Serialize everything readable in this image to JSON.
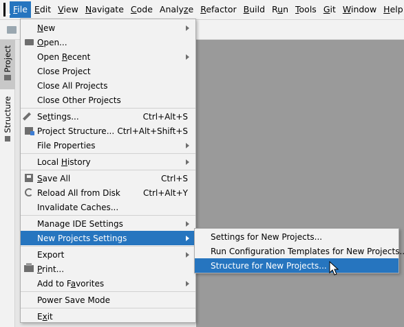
{
  "menubar": {
    "items": [
      {
        "label": "File",
        "mnemonic": "F",
        "rest": "ile",
        "active": true
      },
      {
        "label": "Edit",
        "mnemonic": "E",
        "rest": "dit"
      },
      {
        "label": "View",
        "mnemonic": "V",
        "rest": "iew"
      },
      {
        "label": "Navigate",
        "mnemonic": "N",
        "rest": "avigate"
      },
      {
        "label": "Code",
        "mnemonic": "C",
        "rest": "ode"
      },
      {
        "label": "Analyze",
        "pre": "Analy",
        "mnemonic": "z",
        "rest": "e"
      },
      {
        "label": "Refactor",
        "mnemonic": "R",
        "rest": "efactor"
      },
      {
        "label": "Build",
        "mnemonic": "B",
        "rest": "uild"
      },
      {
        "label": "Run",
        "pre": "R",
        "mnemonic": "u",
        "rest": "n"
      },
      {
        "label": "Tools",
        "mnemonic": "T",
        "rest": "ools"
      },
      {
        "label": "Git",
        "mnemonic": "G",
        "rest": "it"
      },
      {
        "label": "Window",
        "mnemonic": "W",
        "rest": "indow"
      },
      {
        "label": "Help",
        "mnemonic": "H",
        "rest": "elp"
      }
    ]
  },
  "left_stripe": {
    "project_tab": "Project",
    "structure_tab": "Structure"
  },
  "file_menu": {
    "items": [
      {
        "id": "new",
        "label": "New",
        "submenu": true
      },
      {
        "id": "open",
        "label": "Open...",
        "icon": "folder-icon"
      },
      {
        "id": "open-recent",
        "label": "Open Recent",
        "submenu": true
      },
      {
        "id": "close-project",
        "label": "Close Project"
      },
      {
        "id": "close-all-projects",
        "label": "Close All Projects"
      },
      {
        "id": "close-other-projects",
        "label": "Close Other Projects"
      },
      {
        "id": "settings",
        "label": "Settings...",
        "shortcut": "Ctrl+Alt+S",
        "icon": "wrench-icon"
      },
      {
        "id": "project-structure",
        "label": "Project Structure...",
        "shortcut": "Ctrl+Alt+Shift+S",
        "icon": "project-structure-icon"
      },
      {
        "id": "file-properties",
        "label": "File Properties",
        "submenu": true
      },
      {
        "id": "local-history",
        "label": "Local History",
        "submenu": true
      },
      {
        "id": "save-all",
        "label": "Save All",
        "shortcut": "Ctrl+S",
        "icon": "save-icon"
      },
      {
        "id": "reload-all",
        "label": "Reload All from Disk",
        "shortcut": "Ctrl+Alt+Y",
        "icon": "reload-icon"
      },
      {
        "id": "invalidate-caches",
        "label": "Invalidate Caches..."
      },
      {
        "id": "manage-ide-settings",
        "label": "Manage IDE Settings",
        "submenu": true
      },
      {
        "id": "new-projects-settings",
        "label": "New Projects Settings",
        "submenu": true,
        "selected": true
      },
      {
        "id": "export",
        "label": "Export",
        "submenu": true
      },
      {
        "id": "print",
        "label": "Print...",
        "icon": "print-icon"
      },
      {
        "id": "add-to-favorites",
        "label": "Add to Favorites",
        "submenu": true
      },
      {
        "id": "power-save-mode",
        "label": "Power Save Mode"
      },
      {
        "id": "exit",
        "label": "Exit"
      }
    ]
  },
  "submenu": {
    "items": [
      {
        "label": "Settings for New Projects..."
      },
      {
        "label": "Run Configuration Templates for New Projects..."
      },
      {
        "label": "Structure for New Projects...",
        "selected": true
      }
    ]
  },
  "colors": {
    "selection": "#2675bf",
    "menu_bg": "#f2f2f2",
    "editor_bg": "#9a9a9a"
  }
}
